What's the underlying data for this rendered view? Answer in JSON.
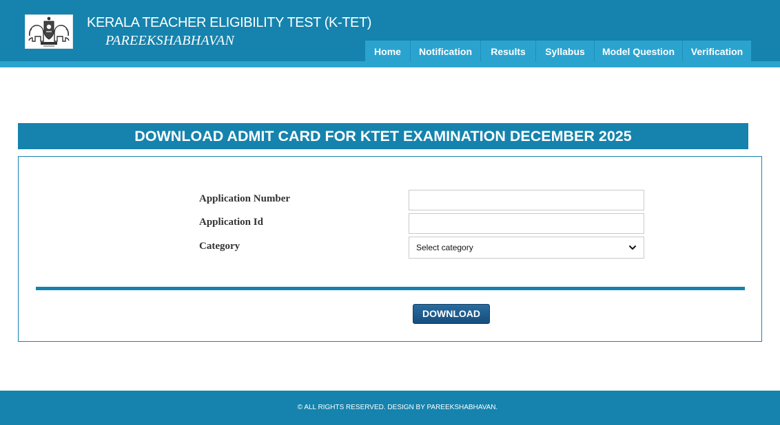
{
  "header": {
    "title": "KERALA TEACHER ELIGIBILITY TEST (K-TET)",
    "subtitle": "PAREEKSHABHAVAN",
    "logo_icon": "kerala-emblem-icon"
  },
  "nav": {
    "items": [
      {
        "label": "Home"
      },
      {
        "label": "Notification"
      },
      {
        "label": "Results"
      },
      {
        "label": "Syllabus"
      },
      {
        "label": "Model Question"
      },
      {
        "label": "Verification"
      }
    ]
  },
  "banner": {
    "title": "DOWNLOAD ADMIT CARD FOR KTET EXAMINATION DECEMBER 2025"
  },
  "form": {
    "application_number": {
      "label": "Application Number",
      "value": "",
      "placeholder": ""
    },
    "application_id": {
      "label": "Application Id",
      "value": "",
      "placeholder": ""
    },
    "category": {
      "label": "Category",
      "selected": "Select category"
    },
    "download_label": "DOWNLOAD"
  },
  "footer": {
    "text": "© ALL RIGHTS RESERVED. DESIGN BY PAREEKSHABHAVAN."
  },
  "colors": {
    "primary": "#1583ad",
    "nav_tab": "#2ba3cf",
    "button": "#1f5f8f"
  }
}
